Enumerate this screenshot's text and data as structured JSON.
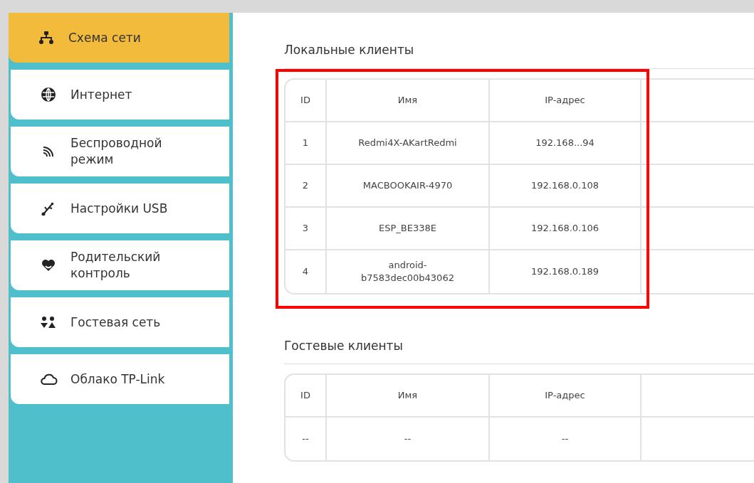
{
  "sidebar": {
    "items": [
      {
        "label": "Схема сети",
        "selected": true
      },
      {
        "label": "Интернет",
        "selected": false
      },
      {
        "label": "Беспроводной режим",
        "selected": false
      },
      {
        "label": "Настройки USB",
        "selected": false
      },
      {
        "label": "Родительский контроль",
        "selected": false
      },
      {
        "label": "Гостевая сеть",
        "selected": false
      },
      {
        "label": "Облако TP-Link",
        "selected": false
      }
    ]
  },
  "sections": [
    {
      "title": "Локальные клиенты",
      "highlighted": true,
      "columns": [
        "ID",
        "Имя",
        "IP-адрес"
      ],
      "rows": [
        [
          "1",
          "Redmi4X-AKartRedmi",
          "192.168...94"
        ],
        [
          "2",
          "MACBOOKAIR-4970",
          "192.168.0.108"
        ],
        [
          "3",
          "ESP_BE338E",
          "192.168.0.106"
        ],
        [
          "4",
          "android-b7583dec00b43062",
          "192.168.0.189"
        ]
      ]
    },
    {
      "title": "Гостевые клиенты",
      "highlighted": false,
      "columns": [
        "ID",
        "Имя",
        "IP-адрес"
      ],
      "rows": [
        [
          "--",
          "--",
          "--"
        ]
      ]
    }
  ]
}
